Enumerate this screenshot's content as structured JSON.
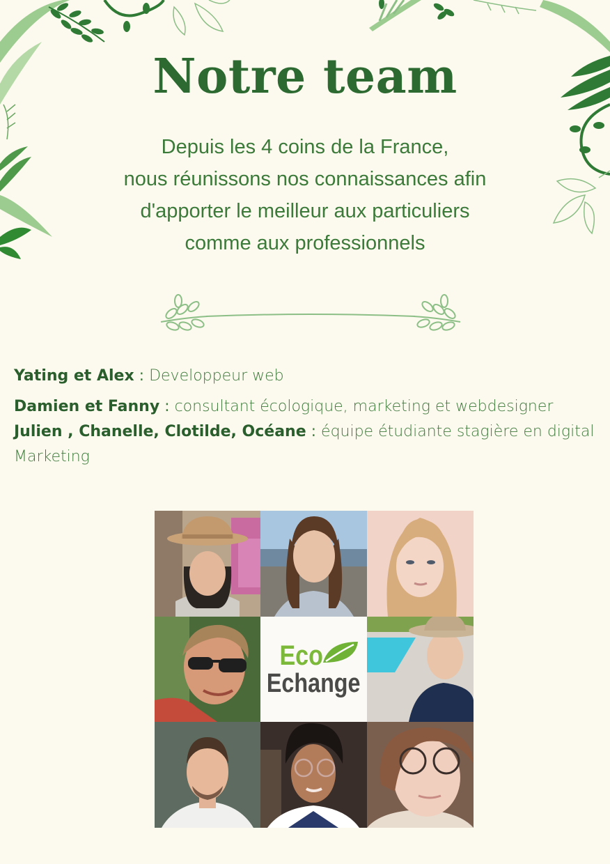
{
  "title": "Notre team",
  "subtitle_lines": [
    "Depuis les 4 coins de la France,",
    "nous réunissons nos connaissances afin",
    "d'apporter le meilleur aux particuliers",
    "comme aux professionnels"
  ],
  "roles": [
    {
      "names": "Yating et Alex",
      "sep": " : ",
      "role": "Developpeur web"
    },
    {
      "names": "Damien et Fanny",
      "sep": " : ",
      "role": "consultant écologique, marketing et webdesigner"
    },
    {
      "names": "Julien , Chanelle, Clotilde, Océane",
      "sep": " : ",
      "role": "équipe étudiante stagière en digital Marketing"
    }
  ],
  "logo": {
    "line1": "Eco",
    "line2": "Echange"
  },
  "colors": {
    "background": "#fcf9ee",
    "title": "#2c6a31",
    "text": "#3c7a3a",
    "logo_green": "#7cb83a",
    "logo_gray": "#4a4a48"
  },
  "photos": [
    "team-member-photo-1",
    "team-member-photo-2",
    "team-member-photo-3",
    "team-member-photo-4",
    "logo",
    "team-member-photo-5",
    "team-member-photo-6",
    "team-member-photo-7",
    "team-member-photo-8"
  ]
}
